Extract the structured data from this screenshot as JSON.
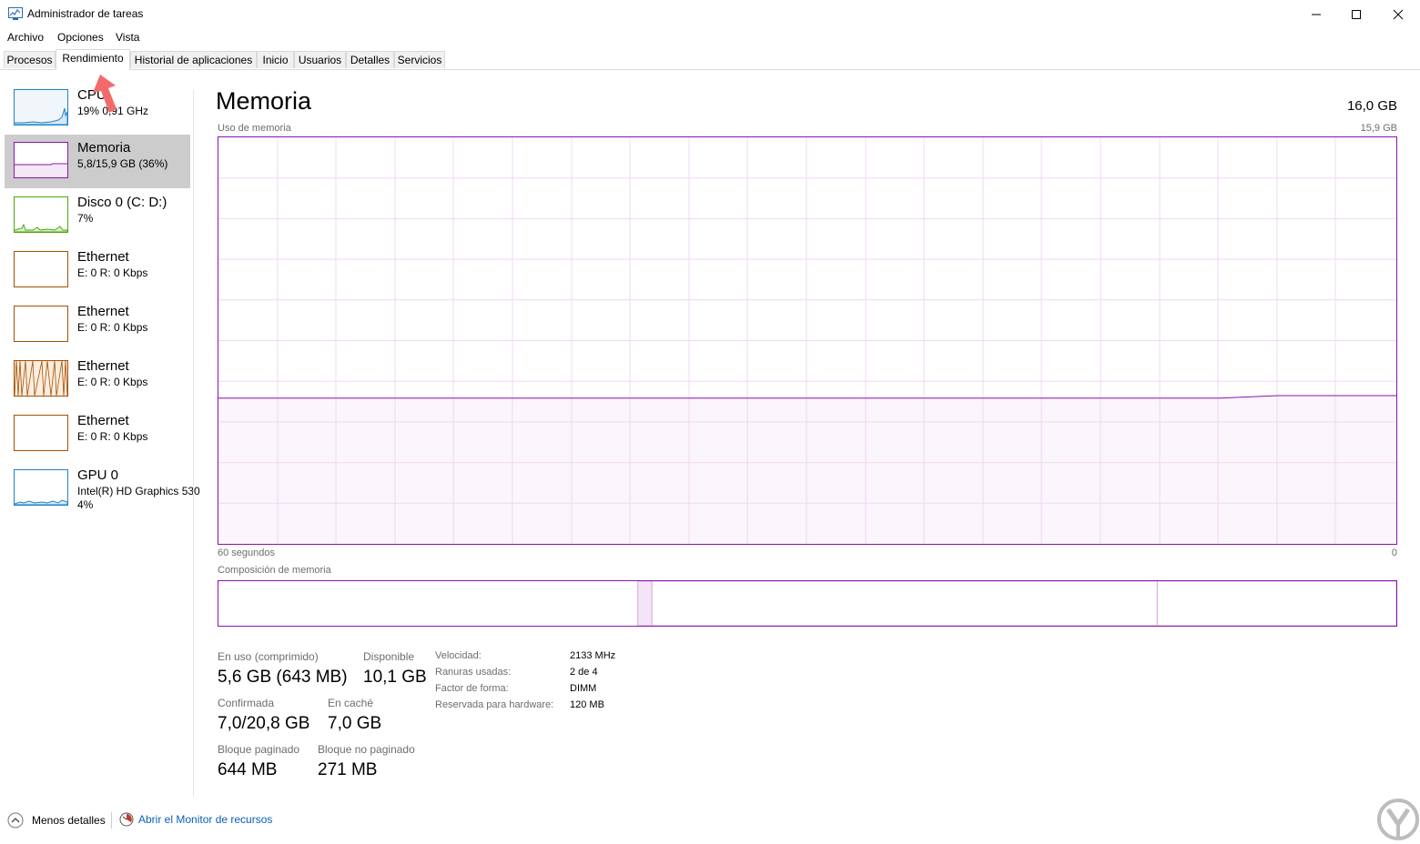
{
  "window": {
    "title": "Administrador de tareas",
    "controls": [
      "—",
      "☐",
      "✕"
    ]
  },
  "menu": [
    "Archivo",
    "Opciones",
    "Vista"
  ],
  "tabs": [
    "Procesos",
    "Rendimiento",
    "Historial de aplicaciones",
    "Inicio",
    "Usuarios",
    "Detalles",
    "Servicios"
  ],
  "active_tab": "Rendimiento",
  "sidebar": [
    {
      "title": "CPU",
      "sub": "19%  0,91 GHz",
      "sub2": "",
      "color": "#1e83c8"
    },
    {
      "title": "Memoria",
      "sub": "5,8/15,9 GB (36%)",
      "sub2": "",
      "color": "#8b12ae"
    },
    {
      "title": "Disco 0 (C: D:)",
      "sub": "7%",
      "sub2": "",
      "color": "#4da60c"
    },
    {
      "title": "Ethernet",
      "sub": "E: 0 R: 0 Kbps",
      "sub2": "",
      "color": "#a74f01"
    },
    {
      "title": "Ethernet",
      "sub": "E: 0 R: 0 Kbps",
      "sub2": "",
      "color": "#a74f01"
    },
    {
      "title": "Ethernet",
      "sub": "E: 0 R: 0 Kbps",
      "sub2": "",
      "color": "#a74f01"
    },
    {
      "title": "Ethernet",
      "sub": "E: 0 R: 0 Kbps",
      "sub2": "",
      "color": "#a74f01"
    },
    {
      "title": "GPU 0",
      "sub": "Intel(R) HD Graphics 530",
      "sub2": "4%",
      "color": "#1e83c8"
    }
  ],
  "main": {
    "title": "Memoria",
    "total": "16,0 GB",
    "usage_label": "Uso de memoria",
    "usage_max": "15,9 GB",
    "time_left": "60 segundos",
    "time_right": "0",
    "composition_label": "Composición de memoria"
  },
  "stats": {
    "in_use_label": "En uso (comprimido)",
    "in_use_value": "5,6 GB (643 MB)",
    "available_label": "Disponible",
    "available_value": "10,1 GB",
    "committed_label": "Confirmada",
    "committed_value": "7,0/20,8 GB",
    "cached_label": "En caché",
    "cached_value": "7,0 GB",
    "paged_label": "Bloque paginado",
    "paged_value": "644 MB",
    "nonpaged_label": "Bloque no paginado",
    "nonpaged_value": "271 MB"
  },
  "details": [
    {
      "label": "Velocidad:",
      "value": "2133 MHz"
    },
    {
      "label": "Ranuras usadas:",
      "value": "2 de 4"
    },
    {
      "label": "Factor de forma:",
      "value": "DIMM"
    },
    {
      "label": "Reservada para hardware:",
      "value": "120 MB"
    }
  ],
  "footer": {
    "less_details": "Menos detalles",
    "resource_monitor": "Abrir el Monitor de recursos"
  },
  "chart_data": {
    "type": "line",
    "title": "Uso de memoria",
    "xlabel": "",
    "ylabel": "",
    "x_range_seconds": [
      60,
      0
    ],
    "ylim": [
      0,
      15.9
    ],
    "series": [
      {
        "values": [
          5.7,
          5.7,
          5.7,
          5.7,
          5.7,
          5.7,
          5.7,
          5.7,
          5.7,
          5.7,
          5.7,
          5.7,
          5.7,
          5.7,
          5.7,
          5.7,
          5.7,
          5.7,
          5.8,
          5.8,
          5.8
        ]
      }
    ],
    "composition_fractions": [
      0.356,
      0.012,
      0.429,
      0.203
    ]
  }
}
